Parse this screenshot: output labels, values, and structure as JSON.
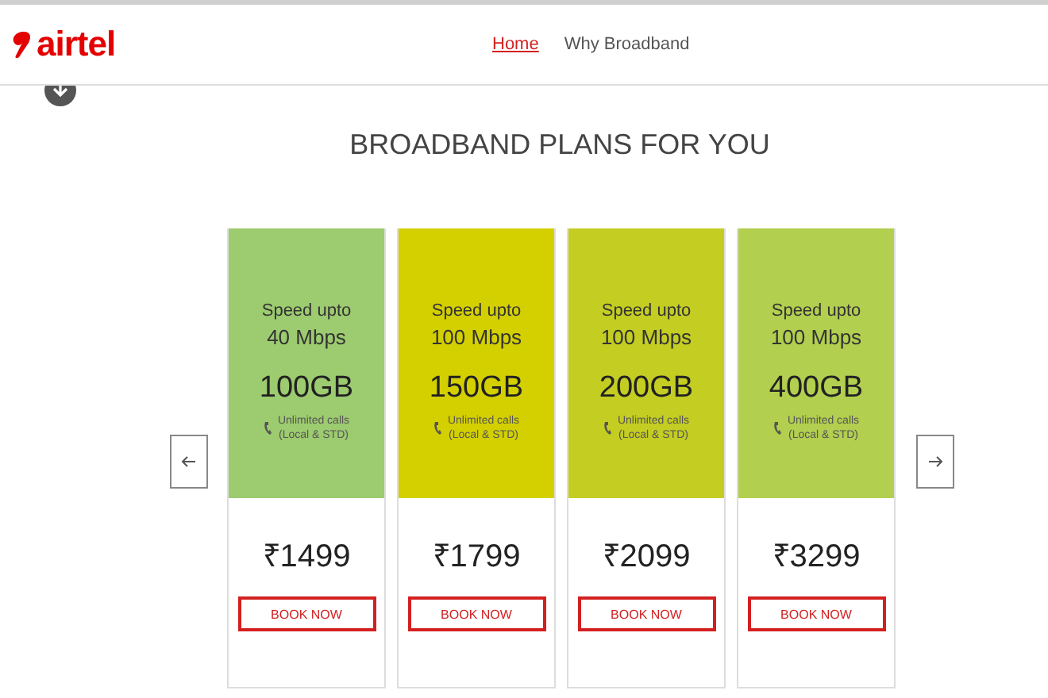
{
  "header": {
    "logo": "airtel",
    "nav": [
      {
        "label": "Home",
        "selected": true
      },
      {
        "label": "Why Broadband",
        "selected": false
      }
    ]
  },
  "title": "BROADBAND PLANS FOR YOU",
  "plans": [
    {
      "speed_label": "Speed upto",
      "speed": "40 Mbps",
      "data": "100GB",
      "calls": "Unlimited calls",
      "calls_note": "(Local & STD)",
      "price": "₹1499",
      "button": "BOOK NOW",
      "color": "#9dcb6f"
    },
    {
      "speed_label": "Speed upto",
      "speed": "100 Mbps",
      "data": "150GB",
      "calls": "Unlimited calls",
      "calls_note": "(Local & STD)",
      "price": "₹1799",
      "button": "BOOK NOW",
      "color": "#d4d000"
    },
    {
      "speed_label": "Speed upto",
      "speed": "100 Mbps",
      "data": "200GB",
      "calls": "Unlimited calls",
      "calls_note": "(Local & STD)",
      "price": "₹2099",
      "button": "BOOK NOW",
      "color": "#c4cd22"
    },
    {
      "speed_label": "Speed upto",
      "speed": "100 Mbps",
      "data": "400GB",
      "calls": "Unlimited calls",
      "calls_note": "(Local & STD)",
      "price": "₹3299",
      "button": "BOOK NOW",
      "color": "#b2cf4f"
    }
  ]
}
